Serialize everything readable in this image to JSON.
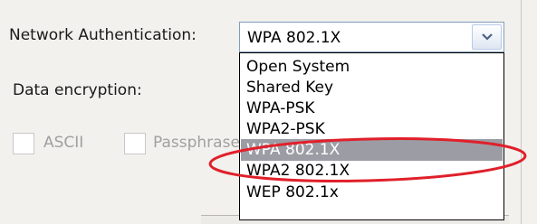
{
  "form": {
    "network_auth_label": "Network Authentication:",
    "data_encryption_label": "Data encryption:",
    "ascii_label": "ASCII",
    "passphrase_label": "Passphrase"
  },
  "auth_select": {
    "value": "WPA 802.1X",
    "options": [
      {
        "label": "Open System"
      },
      {
        "label": "Shared Key"
      },
      {
        "label": "WPA-PSK"
      },
      {
        "label": "WPA2-PSK"
      },
      {
        "label": "WPA 802.1X"
      },
      {
        "label": "WPA2 802.1X"
      },
      {
        "label": "WEP 802.1x"
      }
    ],
    "selected_index": 4
  },
  "colors": {
    "highlight_ellipse": "#e0202a",
    "selected_option_bg": "#9c9ca4",
    "combo_border": "#7f9db9"
  },
  "icons": {
    "dropdown": "chevron-down-icon",
    "annotation": "red-ellipse-annotation"
  }
}
